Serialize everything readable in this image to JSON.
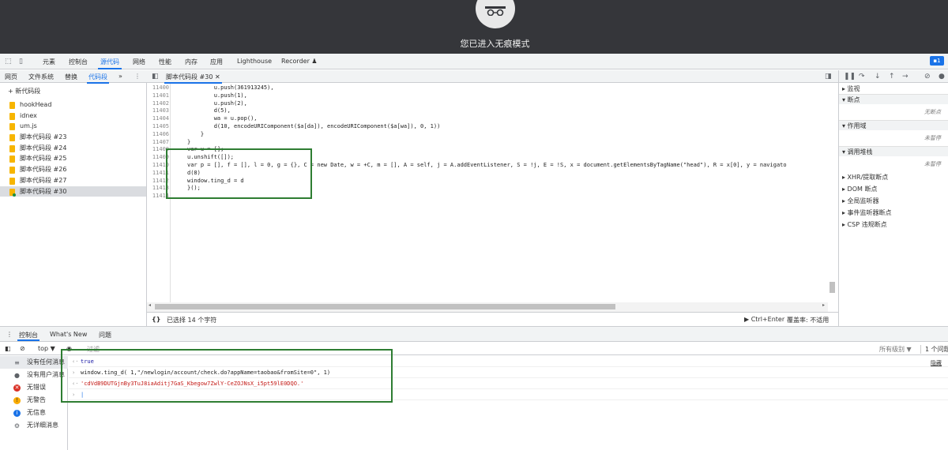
{
  "banner": {
    "message": "您已进入无痕模式"
  },
  "devtools_tabs": [
    "元素",
    "控制台",
    "源代码",
    "网络",
    "性能",
    "内存",
    "应用",
    "Lighthouse",
    "Recorder ♟"
  ],
  "active_tab_index": 2,
  "msg_badge": "1",
  "sources": {
    "nav_tabs": [
      "网页",
      "文件系统",
      "替换",
      "代码段",
      "»"
    ],
    "active_nav_index": 3,
    "new_snippet": "+ 新代码段",
    "snippets": [
      "hookHead",
      "idnex",
      "um.js",
      "脚本代码段 #23",
      "脚本代码段 #24",
      "脚本代码段 #25",
      "脚本代码段 #26",
      "脚本代码段 #27",
      "脚本代码段 #30"
    ],
    "selected_snippet_index": 8
  },
  "editor": {
    "tab": "脚本代码段 #30",
    "line_numbers": [
      "11400",
      "11401",
      "11402",
      "11403",
      "11404",
      "11405",
      "11406",
      "11407",
      "11408",
      "11409",
      "11410",
      "11411",
      "11412",
      "11413",
      "11414"
    ],
    "code_lines": [
      "        u.push(361913245),",
      "        u.push(1),",
      "        u.push(2),",
      "        d(5),",
      "        wa = u.pop(),",
      "        d(10, encodeURIComponent($a[da]), encodeURIComponent($a[wa]), 0, 1))",
      "    }",
      "}",
      "var u = [];",
      "u.unshift([]);",
      "var p = [], f = [], l = 0, g = {}, C = new Date, w = +C, m = [], A = self, j = A.addEventListener, S = !j, E = !S, x = document.getElementsByTagName(\"head\"), R = x[0], y = navigato",
      "d(8)",
      "window.ting_d = d",
      "}();",
      ""
    ],
    "status_left": "{}",
    "status_selection": "已选择 14 个字符",
    "status_run": "▶ Ctrl+Enter",
    "status_coverage": "覆盖率: 不适用"
  },
  "debugger": {
    "sections": [
      {
        "label": "▸ 监视",
        "header": false
      },
      {
        "label": "▾ 断点",
        "header": true
      },
      {
        "label": "无断点",
        "note": true
      },
      {
        "label": "▾ 作用域",
        "header": true
      },
      {
        "label": "未暂停",
        "note": true
      },
      {
        "label": "▾ 调用堆栈",
        "header": true
      },
      {
        "label": "未暂停",
        "note": true
      },
      {
        "label": "▸ XHR/提取断点",
        "header": false
      },
      {
        "label": "▸ DOM 断点",
        "header": false
      },
      {
        "label": "▸ 全局监听器",
        "header": false
      },
      {
        "label": "▸ 事件监听器断点",
        "header": false
      },
      {
        "label": "▸ CSP 违规断点",
        "header": false
      }
    ]
  },
  "drawer": {
    "tabs": [
      "控制台",
      "What's New",
      "问题"
    ],
    "context": "top ▼",
    "filter_placeholder": "过滤",
    "levels": "所有级别 ▼",
    "issues": "1 个问题",
    "hide_btn": "隐藏",
    "sidebar": [
      "没有任何消息",
      "没有用户消息",
      "无错误",
      "无警告",
      "无信息",
      "无详细消息"
    ],
    "log": [
      {
        "prefix": "‹·",
        "text": "true",
        "color": "#1a1aa6"
      },
      {
        "prefix": "›",
        "text": "window.ting_d( 1,\"/newlogin/account/check.do?appName=taobao&fromSite=0\", 1)",
        "color": "#222"
      },
      {
        "prefix": "‹·",
        "text": "'cdVdB9DUTGjnBy3TuJ8iaAditj7GaS_Kbegow7ZwlY-CeZOJNsX_i5pt59lE0DQO.'",
        "color": "#c41a16"
      },
      {
        "prefix": "›",
        "text": "|",
        "color": "#1a73e8"
      }
    ]
  }
}
